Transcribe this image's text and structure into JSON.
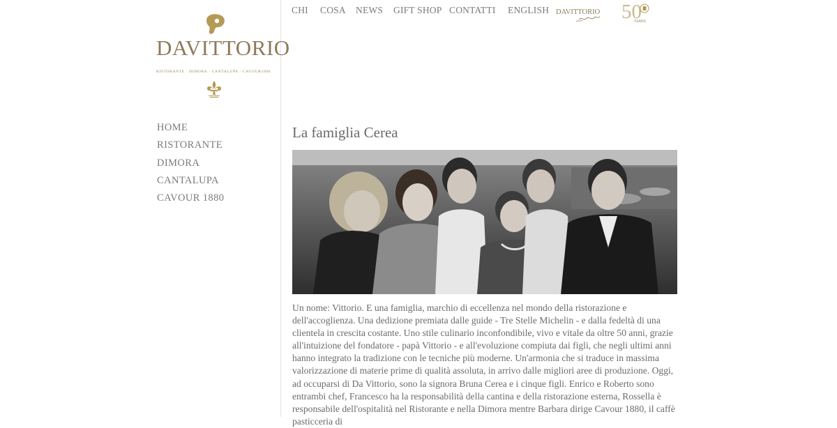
{
  "logo": {
    "word_prefix": "DA",
    "word_main": "VITTORIO",
    "subtitle": "RISTORANTE · DIMORA · CANTALUPA · CAVOUR1880",
    "brand_color": "#8e7a5a",
    "gold_color": "#b59a55"
  },
  "top_nav": {
    "items": [
      {
        "label": "CHI"
      },
      {
        "label": "COSA"
      },
      {
        "label": "NEWS"
      },
      {
        "label": "GIFT SHOP"
      },
      {
        "label": "CONTATTI"
      },
      {
        "label": "ENGLISH"
      }
    ],
    "sig_logo_word": "DAVITTORIO",
    "years_number": "50",
    "years_label": "YEARS"
  },
  "side_nav": {
    "items": [
      {
        "label": "HOME"
      },
      {
        "label": "RISTORANTE"
      },
      {
        "label": "DIMORA"
      },
      {
        "label": "CANTALUPA"
      },
      {
        "label": "CAVOUR 1880"
      }
    ]
  },
  "main": {
    "title": "La famiglia Cerea",
    "body": "Un nome: Vittorio. E una famiglia, marchio di eccellenza nel mondo della ristorazione e dell'accoglienza. Una dedizione premiata dalle guide - Tre Stelle Michelin - e dalla fedeltà di una clientela in crescita costante. Uno stile culinario inconfondibile, vivo e vitale da oltre 50 anni, grazie all'intuizione del fondatore - papà Vittorio - e all'evoluzione compiuta dai figli, che negli ultimi anni hanno integrato la tradizione con le tecniche più moderne. Un'armonia che si traduce in massima valorizzazione di materie prime di qualità assoluta, in arrivo dalle migliori aree di produzione. Oggi, ad occuparsi di Da Vittorio, sono la signora Bruna Cerea e i cinque figli. Enrico e Roberto sono entrambi chef, Francesco ha la responsabilità della cantina e della ristorazione esterna, Rossella è responsabile dell'ospitalità nel Ristorante e nella Dimora mentre Barbara dirige Cavour 1880, il caffè pasticceria di"
  }
}
